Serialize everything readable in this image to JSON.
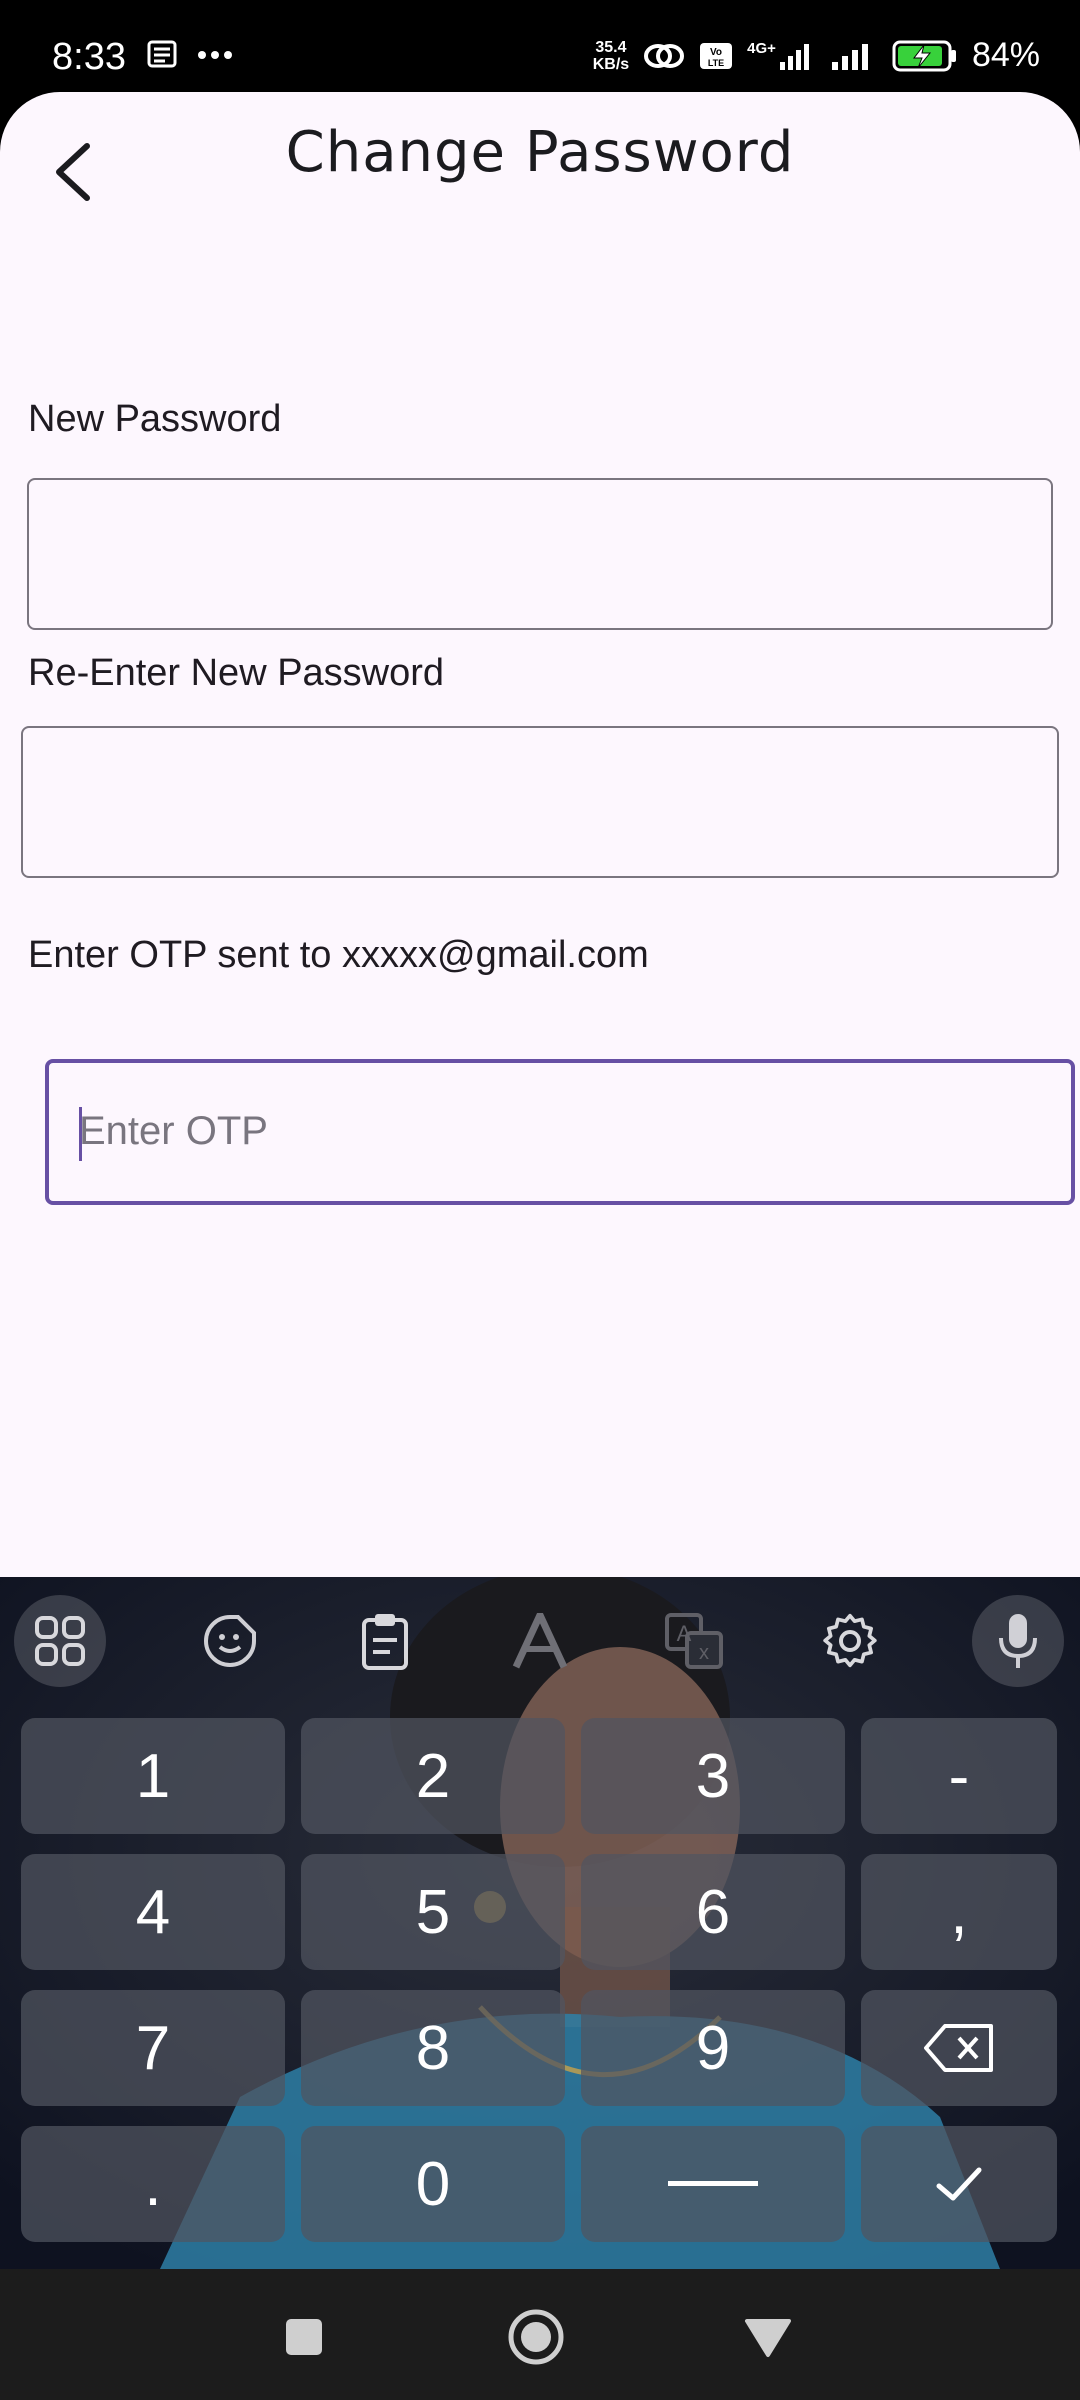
{
  "status_bar": {
    "time": "8:33",
    "net_speed_value": "35.4",
    "net_speed_unit": "KB/s",
    "network_label": "4G+",
    "battery_percent": "84%"
  },
  "header": {
    "title": "Change Password"
  },
  "form": {
    "new_password_label": "New Password",
    "reenter_password_label": "Re-Enter New Password",
    "otp_instruction": "Enter OTP sent to xxxxx@gmail.com",
    "otp_placeholder": "Enter OTP"
  },
  "keyboard": {
    "keys": [
      "1",
      "2",
      "3",
      "-",
      "4",
      "5",
      "6",
      ",",
      "7",
      "8",
      "9",
      ".",
      "0"
    ],
    "toolbar_icons": [
      "grid-icon",
      "sticker-icon",
      "clipboard-icon",
      "text-style-icon",
      "translate-icon",
      "settings-icon",
      "mic-icon"
    ]
  },
  "colors": {
    "accent": "#6750a4",
    "background": "#fdf7fe"
  }
}
